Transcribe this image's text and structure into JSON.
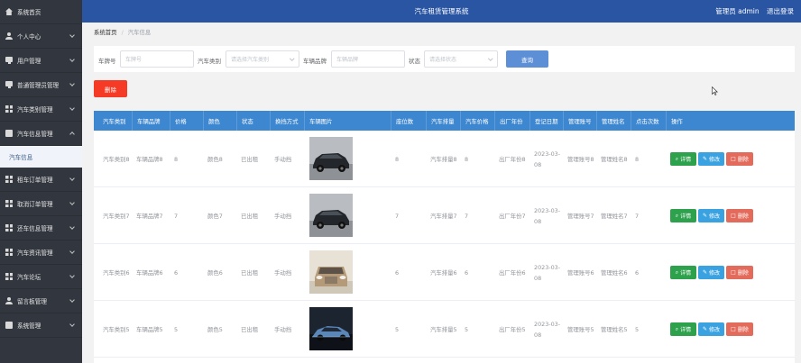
{
  "sidebar": {
    "items": [
      {
        "label": "系统首页",
        "icon": "home-icon",
        "has_arrow": false
      },
      {
        "label": "个人中心",
        "icon": "user-icon",
        "has_arrow": true
      },
      {
        "label": "用户管理",
        "icon": "monitor-icon",
        "has_arrow": true
      },
      {
        "label": "普通管理员管理",
        "icon": "monitor-icon",
        "has_arrow": true
      },
      {
        "label": "汽车类别管理",
        "icon": "grid-icon",
        "has_arrow": true
      },
      {
        "label": "汽车信息管理",
        "icon": "box-icon",
        "has_arrow": true,
        "open": true
      },
      {
        "label": "汽车信息",
        "sub": true
      },
      {
        "label": "租车订单管理",
        "icon": "grid-icon",
        "has_arrow": true
      },
      {
        "label": "取消订单管理",
        "icon": "grid-icon",
        "has_arrow": true
      },
      {
        "label": "还车信息管理",
        "icon": "grid-icon",
        "has_arrow": true
      },
      {
        "label": "汽车资讯管理",
        "icon": "grid-icon",
        "has_arrow": true
      },
      {
        "label": "汽车论坛",
        "icon": "grid-icon",
        "has_arrow": true
      },
      {
        "label": "留言板管理",
        "icon": "user-icon",
        "has_arrow": true
      },
      {
        "label": "系统管理",
        "icon": "box-icon",
        "has_arrow": true
      }
    ]
  },
  "header": {
    "title": "汽车租赁管理系统",
    "user": "管理员 admin",
    "logout": "退出登录"
  },
  "breadcrumb": {
    "home": "系统首页",
    "current": "汽车信息"
  },
  "search": {
    "plate_label": "车牌号",
    "plate_placeholder": "车牌号",
    "category_label": "汽车类别",
    "category_placeholder": "请选择汽车类别",
    "brand_label": "车辆品牌",
    "brand_placeholder": "车辆品牌",
    "status_label": "状态",
    "status_placeholder": "请选择状态",
    "query_label": "查询"
  },
  "toolbar": {
    "delete_label": "删除"
  },
  "table": {
    "columns": [
      "汽车类别",
      "车辆品牌",
      "价格",
      "颜色",
      "状态",
      "换挡方式",
      "车辆图片",
      "座位数",
      "汽车排量",
      "汽车价格",
      "出厂年份",
      "登记日期",
      "管理账号",
      "管理姓名",
      "点击次数",
      "操作"
    ],
    "rows": [
      {
        "category": "汽车类别8",
        "brand": "车辆品牌8",
        "price": "8",
        "color": "颜色8",
        "status": "已出租",
        "gear": "手动挡",
        "seats": "8",
        "displacement": "汽车排量8",
        "car_price": "8",
        "year": "出厂年份8",
        "reg_date": "2023-03-08",
        "account": "管理账号8",
        "name": "管理姓名8",
        "clicks": "8",
        "img": "suv-dark"
      },
      {
        "category": "汽车类别7",
        "brand": "车辆品牌7",
        "price": "7",
        "color": "颜色7",
        "status": "已出租",
        "gear": "手动挡",
        "seats": "7",
        "displacement": "汽车排量7",
        "car_price": "7",
        "year": "出厂年份7",
        "reg_date": "2023-03-08",
        "account": "管理账号7",
        "name": "管理姓名7",
        "clicks": "7",
        "img": "suv-dark"
      },
      {
        "category": "汽车类别6",
        "brand": "车辆品牌6",
        "price": "6",
        "color": "颜色6",
        "status": "已出租",
        "gear": "手动挡",
        "seats": "6",
        "displacement": "汽车排量6",
        "car_price": "6",
        "year": "出厂年份6",
        "reg_date": "2023-03-08",
        "account": "管理账号6",
        "name": "管理姓名6",
        "clicks": "6",
        "img": "sedan-front"
      },
      {
        "category": "汽车类别5",
        "brand": "车辆品牌5",
        "price": "5",
        "color": "颜色5",
        "status": "已出租",
        "gear": "手动挡",
        "seats": "5",
        "displacement": "汽车排量5",
        "car_price": "5",
        "year": "出厂年份5",
        "reg_date": "2023-03-08",
        "account": "管理账号5",
        "name": "管理姓名5",
        "clicks": "5",
        "img": "sports-blue"
      }
    ],
    "actions": {
      "detail": "详情",
      "edit": "修改",
      "delete": "删除"
    }
  },
  "colors": {
    "topbar": "#2a55a3",
    "sidebar": "#32373f",
    "thead": "#3d87d0",
    "danger": "#f53a25",
    "primary": "#5c8fd6"
  }
}
